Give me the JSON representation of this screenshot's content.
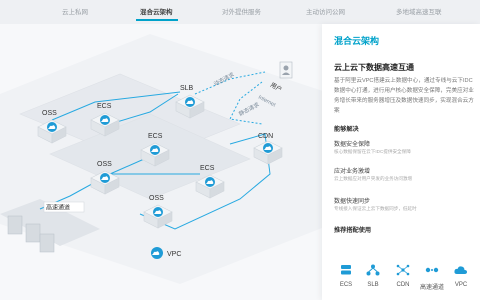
{
  "tabs": [
    {
      "label": "云上私网"
    },
    {
      "label": "混合云架构"
    },
    {
      "label": "对外提供服务"
    },
    {
      "label": "主动访问公网"
    },
    {
      "label": "多地域高速互联"
    }
  ],
  "active_tab": 1,
  "diagram": {
    "nodes": {
      "oss1": "OSS",
      "ecs1": "ECS",
      "slb": "SLB",
      "ecs2": "ECS",
      "oss2": "OSS",
      "ecs3": "ECS",
      "oss3": "OSS",
      "cdn": "CDN",
      "user": "用户",
      "internet": "Internet",
      "vpc": "VPC",
      "highspeed": "高速通道"
    },
    "paths": {
      "dynamic": "动态请求",
      "static": "静态请求"
    }
  },
  "panel": {
    "title": "混合云架构",
    "headline": "云上云下数据高速互通",
    "description": "基于阿里云VPC搭建云上数据中心，通过专线与云下IDC数据中心打通，进行用户核心数据安全保障，完美应对业务增长带来的服务器增压及数据快速同步，实现混合云方案",
    "capability_title": "能够解决",
    "features": [
      {
        "title": "数据安全保障",
        "desc": "核心数据保留在云下IDC提供安全保障"
      },
      {
        "title": "应对业务激增",
        "desc": "云上数据应对用户突发的业务访问激增"
      },
      {
        "title": "数据快速同步",
        "desc": "专线接入保证云上云下数据同步，低延时"
      }
    ],
    "products_title": "推荐搭配使用",
    "products": [
      {
        "label": "ECS",
        "icon": "server-icon"
      },
      {
        "label": "SLB",
        "icon": "network-icon"
      },
      {
        "label": "CDN",
        "icon": "cdn-icon"
      },
      {
        "label": "高速通道",
        "icon": "express-connect-icon"
      },
      {
        "label": "VPC",
        "icon": "cloud-icon"
      }
    ]
  },
  "colors": {
    "accent": "#00a2ca",
    "line": "#27a9e1",
    "node_blue": "#1f9bd6"
  }
}
